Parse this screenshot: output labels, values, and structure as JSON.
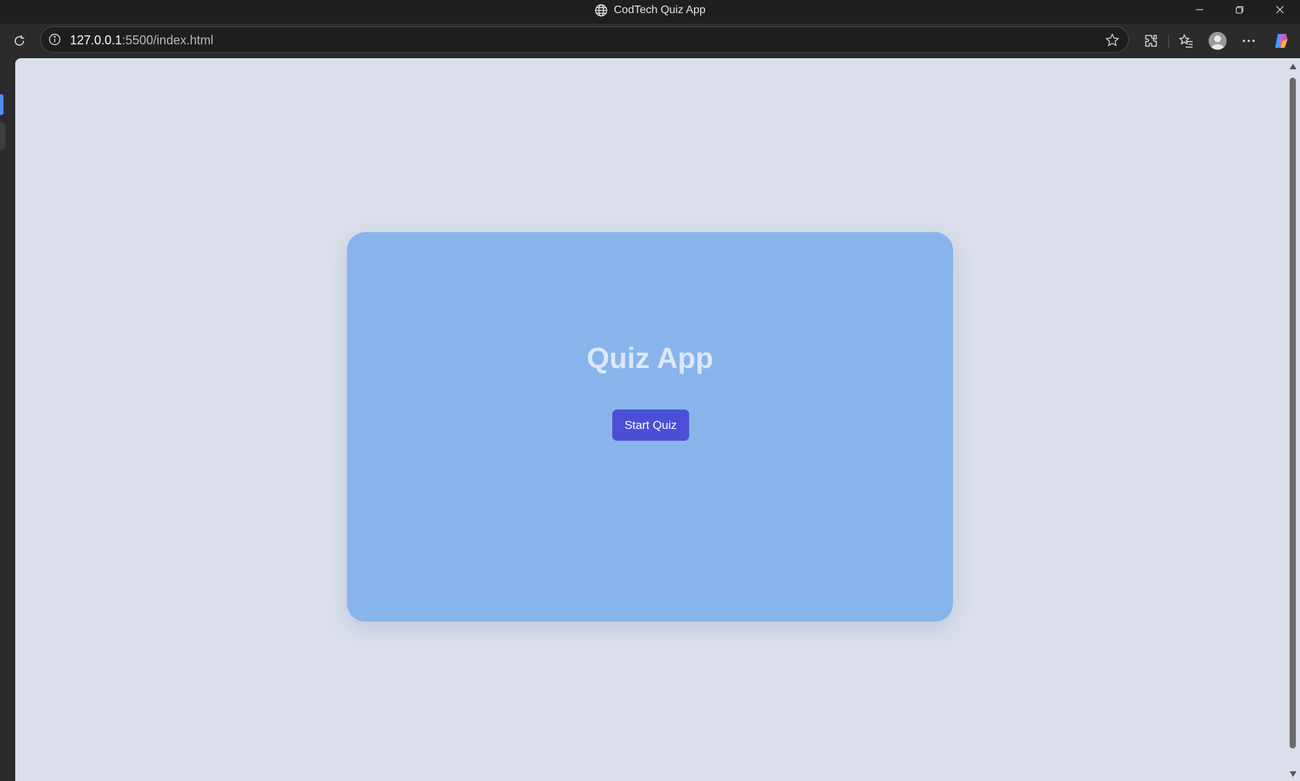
{
  "window": {
    "title": "CodTech Quiz App",
    "controls": [
      "minimize",
      "restore",
      "close"
    ]
  },
  "toolbar": {
    "url_host": "127.0.0.1",
    "url_rest": ":5500/index.html",
    "icons": [
      "reload-icon",
      "site-info-icon",
      "star-icon",
      "extensions-icon",
      "favorites-icon",
      "profile-icon",
      "more-icon",
      "copilot-icon"
    ]
  },
  "page": {
    "title": "Quiz App",
    "start_button_label": "Start Quiz"
  },
  "colors": {
    "page_background": "#dadfe9",
    "card_background": "#88b4ec",
    "title_color": "#dce8f8",
    "button_background": "#4b4fd6",
    "button_text": "#ffffff",
    "browser_chrome": "#2b2b2b"
  }
}
